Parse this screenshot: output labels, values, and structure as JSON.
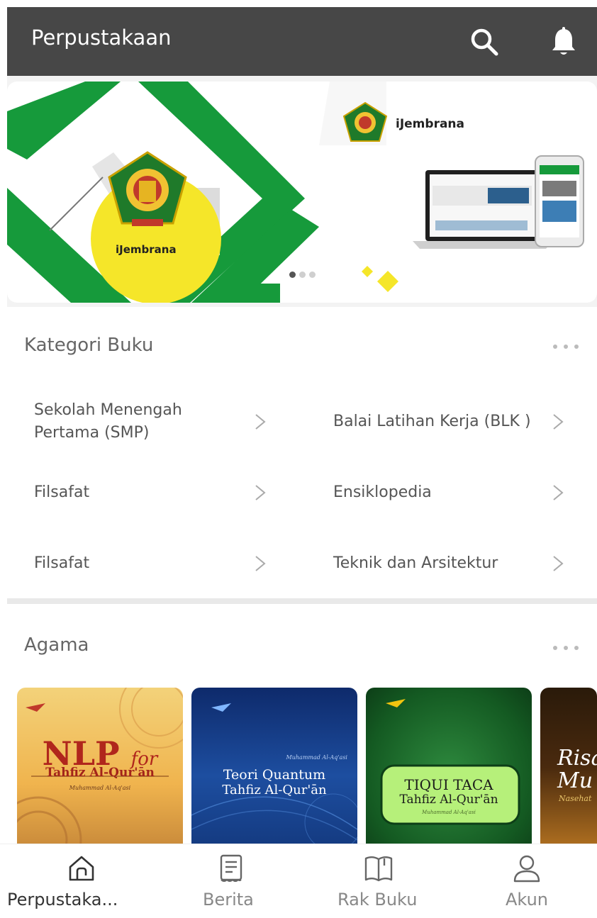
{
  "header": {
    "title": "Perpustakaan",
    "search_icon": "search-icon",
    "bell_icon": "bell-icon"
  },
  "banner": {
    "brand_left": "iJembrana",
    "brand_right": "iJembrana",
    "slide_count": 3,
    "active_slide": 1,
    "colors": {
      "green": "#169a3b",
      "yellow": "#f5e629"
    }
  },
  "categories": {
    "title": "Kategori Buku",
    "more_icon": "more-horizontal-icon",
    "items": [
      {
        "label": "Sekolah Menengah Pertama (SMP)"
      },
      {
        "label": "Balai Latihan Kerja (BLK )"
      },
      {
        "label": "Filsafat"
      },
      {
        "label": "Ensiklopedia"
      },
      {
        "label": "Filsafat"
      },
      {
        "label": "Teknik dan Arsitektur"
      }
    ]
  },
  "agama": {
    "title": "Agama",
    "more_icon": "more-horizontal-icon",
    "books": [
      {
        "title_line1": "NLP",
        "title_for": "for",
        "title_line2": "Tahfiz Al-Qur'ān",
        "author": "Muhammad Al-Aq'asi"
      },
      {
        "title_line1": "Teori Quantum",
        "title_line2": "Tahfiz Al-Qur'ān",
        "author": "Muhammad Al-Aq'asi"
      },
      {
        "title_line1": "TIQUI TACA",
        "title_line2": "Tahfiz Al-Qur'ān",
        "author": "Muhammad Al-Aq'asi"
      },
      {
        "title_line1": "Risa",
        "title_line2": "Mu",
        "subtitle": "Nasehat"
      }
    ]
  },
  "nav": {
    "items": [
      {
        "label": "Perpustaka...",
        "icon": "home-icon",
        "active": true
      },
      {
        "label": "Berita",
        "icon": "news-icon",
        "active": false
      },
      {
        "label": "Rak Buku",
        "icon": "book-open-icon",
        "active": false
      },
      {
        "label": "Akun",
        "icon": "user-icon",
        "active": false
      }
    ]
  }
}
